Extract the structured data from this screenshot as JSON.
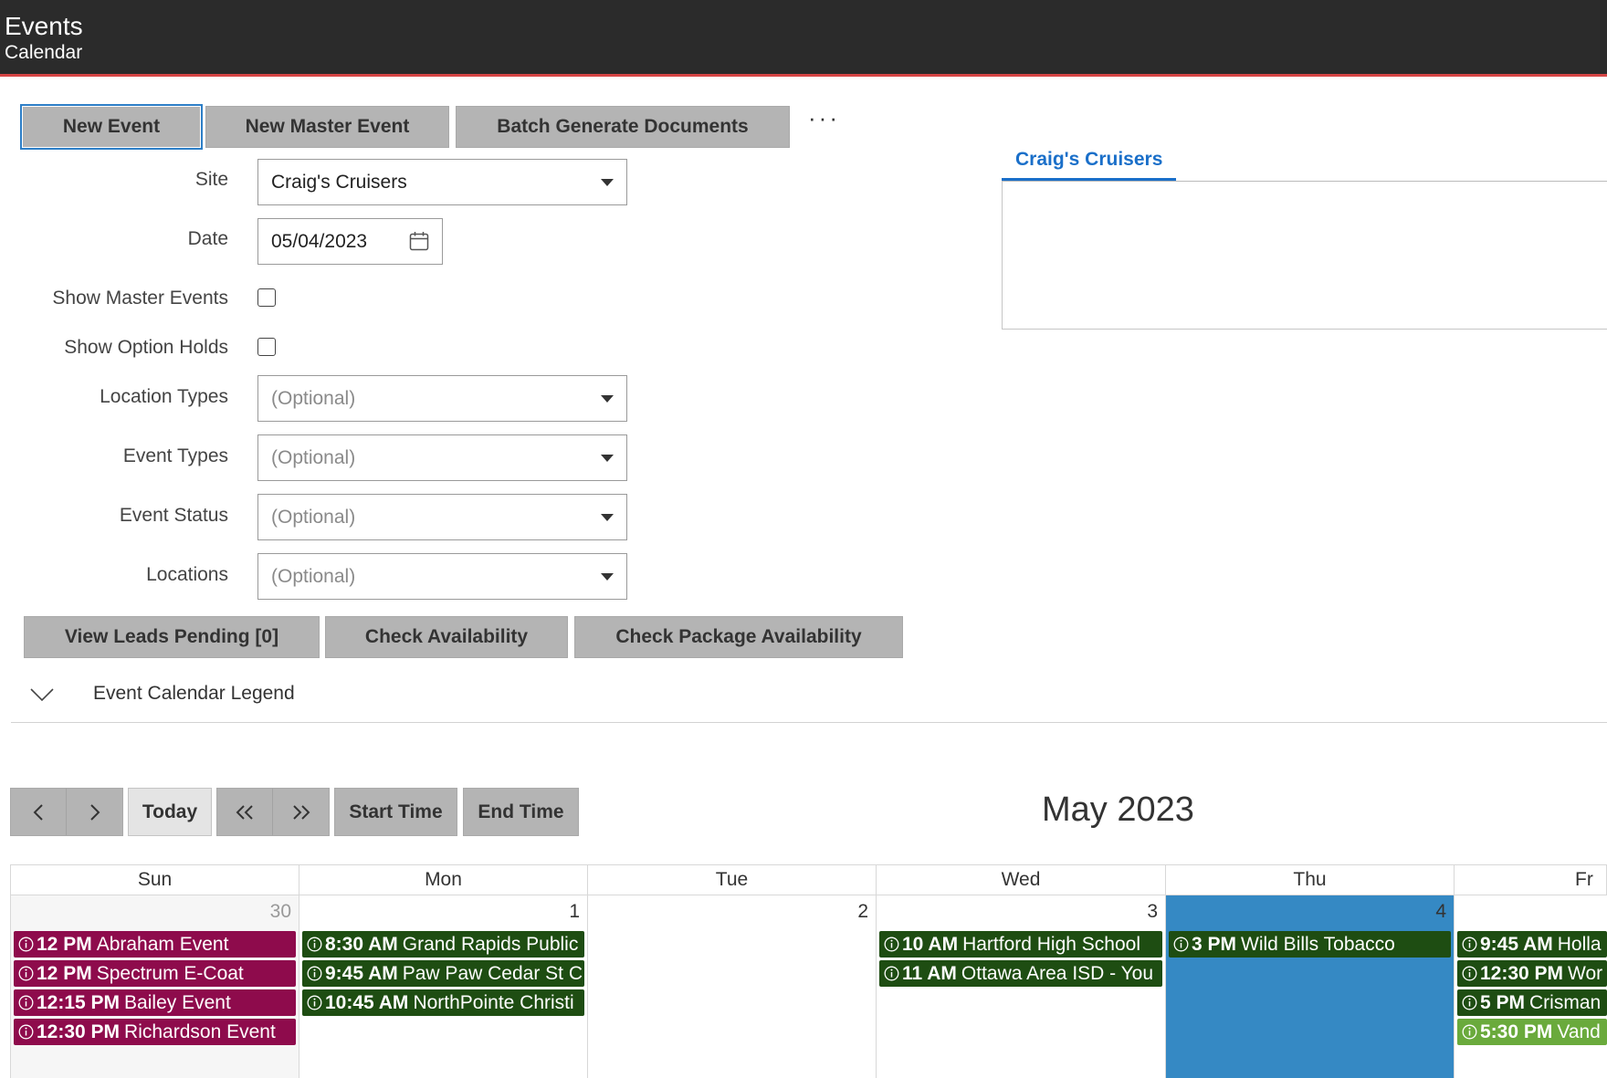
{
  "header": {
    "title": "Events",
    "subtitle": "Calendar"
  },
  "toolbar": {
    "new_event": "New Event",
    "new_master_event": "New Master Event",
    "batch_generate": "Batch Generate Documents",
    "more": "···"
  },
  "form": {
    "site_label": "Site",
    "site_value": "Craig's Cruisers",
    "date_label": "Date",
    "date_value": "05/04/2023",
    "show_master_label": "Show Master Events",
    "show_option_holds_label": "Show Option Holds",
    "location_types_label": "Location Types",
    "event_types_label": "Event Types",
    "event_status_label": "Event Status",
    "locations_label": "Locations",
    "optional_placeholder": "(Optional)"
  },
  "actions": {
    "view_leads": "View Leads Pending [0]",
    "check_availability": "Check Availability",
    "check_package": "Check Package Availability"
  },
  "site_tab": {
    "label": "Craig's Cruisers"
  },
  "legend": {
    "label": "Event Calendar Legend"
  },
  "calendar_nav": {
    "today": "Today",
    "start_time": "Start Time",
    "end_time": "End Time",
    "month_title": "May 2023"
  },
  "calendar": {
    "weekdays": [
      "Sun",
      "Mon",
      "Tue",
      "Wed",
      "Thu",
      "Fr"
    ],
    "days": [
      {
        "num": "30",
        "events": [
          {
            "time": "12 PM",
            "title": "Abraham Event"
          },
          {
            "time": "12 PM",
            "title": "Spectrum E-Coat"
          },
          {
            "time": "12:15 PM",
            "title": "Bailey Event"
          },
          {
            "time": "12:30 PM",
            "title": "Richardson Event"
          }
        ]
      },
      {
        "num": "1",
        "events": [
          {
            "time": "8:30 AM",
            "title": "Grand Rapids Public"
          },
          {
            "time": "9:45 AM",
            "title": "Paw Paw Cedar St C"
          },
          {
            "time": "10:45 AM",
            "title": "NorthPointe Christi"
          }
        ]
      },
      {
        "num": "2",
        "events": []
      },
      {
        "num": "3",
        "events": [
          {
            "time": "10 AM",
            "title": "Hartford High School"
          },
          {
            "time": "11 AM",
            "title": "Ottawa Area ISD - You"
          }
        ]
      },
      {
        "num": "4",
        "events": [
          {
            "time": "3 PM",
            "title": "Wild Bills Tobacco"
          }
        ]
      },
      {
        "num": "",
        "events": [
          {
            "time": "9:45 AM",
            "title": "Holla"
          },
          {
            "time": "12:30 PM",
            "title": "Wor"
          },
          {
            "time": "5 PM",
            "title": "Crisman"
          },
          {
            "time": "5:30 PM",
            "title": "Vand"
          }
        ]
      }
    ]
  },
  "colors": {
    "header_bg": "#2b2b2b",
    "header_accent": "#d64545",
    "button_gray": "#b4b4b4",
    "link_blue": "#1a6fc9",
    "today_blue": "#3589c4",
    "event_maroon": "#8e0b4c",
    "event_green": "#1e4d12",
    "event_light_green": "#6aaa3c"
  }
}
